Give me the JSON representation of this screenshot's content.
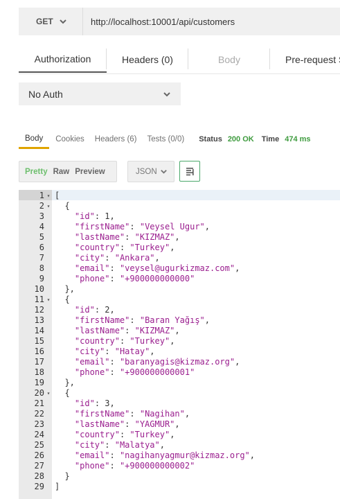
{
  "request": {
    "method": "GET",
    "url": "http://localhost:10001/api/customers"
  },
  "request_tabs": [
    {
      "label": "Authorization",
      "state": "active"
    },
    {
      "label": "Headers (0)",
      "state": "normal"
    },
    {
      "label": "Body",
      "state": "disabled"
    },
    {
      "label": "Pre-request S",
      "state": "normal"
    }
  ],
  "auth": {
    "type": "No Auth"
  },
  "response_tabs": [
    {
      "label": "Body",
      "state": "active"
    },
    {
      "label": "Cookies",
      "state": "normal"
    },
    {
      "label": "Headers (6)",
      "state": "normal"
    },
    {
      "label": "Tests (0/0)",
      "state": "normal"
    }
  ],
  "status": {
    "status_label": "Status",
    "status_value": "200 OK",
    "time_label": "Time",
    "time_value": "474 ms"
  },
  "viewer": {
    "modes": [
      "Pretty",
      "Raw",
      "Preview"
    ],
    "active_mode": "Pretty",
    "format": "JSON"
  },
  "colors": {
    "accent_tab": "#e0a400",
    "status_ok": "#3e9b3e",
    "json_string": "#9a1d8e",
    "wrap_border": "#4aa86a"
  },
  "code_lines": [
    {
      "n": "1",
      "fold": true,
      "text": "["
    },
    {
      "n": "2",
      "fold": true,
      "text": "  {"
    },
    {
      "n": "3",
      "key": "\"id\"",
      "num": "1",
      "indent": "    ",
      "tail": ","
    },
    {
      "n": "4",
      "key": "\"firstName\"",
      "str": "\"Veysel Ugur\"",
      "indent": "    ",
      "tail": ","
    },
    {
      "n": "5",
      "key": "\"lastName\"",
      "str": "\"KIZMAZ\"",
      "indent": "    ",
      "tail": ","
    },
    {
      "n": "6",
      "key": "\"country\"",
      "str": "\"Turkey\"",
      "indent": "    ",
      "tail": ","
    },
    {
      "n": "7",
      "key": "\"city\"",
      "str": "\"Ankara\"",
      "indent": "    ",
      "tail": ","
    },
    {
      "n": "8",
      "key": "\"email\"",
      "str": "\"veysel@ugurkizmaz.com\"",
      "indent": "    ",
      "tail": ","
    },
    {
      "n": "9",
      "key": "\"phone\"",
      "str": "\"+900000000000\"",
      "indent": "    ",
      "tail": ""
    },
    {
      "n": "10",
      "text": "  },"
    },
    {
      "n": "11",
      "fold": true,
      "text": "  {"
    },
    {
      "n": "12",
      "key": "\"id\"",
      "num": "2",
      "indent": "    ",
      "tail": ","
    },
    {
      "n": "13",
      "key": "\"firstName\"",
      "str": "\"Baran Yağış\"",
      "indent": "    ",
      "tail": ","
    },
    {
      "n": "14",
      "key": "\"lastName\"",
      "str": "\"KIZMAZ\"",
      "indent": "    ",
      "tail": ","
    },
    {
      "n": "15",
      "key": "\"country\"",
      "str": "\"Turkey\"",
      "indent": "    ",
      "tail": ","
    },
    {
      "n": "16",
      "key": "\"city\"",
      "str": "\"Hatay\"",
      "indent": "    ",
      "tail": ","
    },
    {
      "n": "17",
      "key": "\"email\"",
      "str": "\"baranyagis@kizmaz.org\"",
      "indent": "    ",
      "tail": ","
    },
    {
      "n": "18",
      "key": "\"phone\"",
      "str": "\"+900000000001\"",
      "indent": "    ",
      "tail": ""
    },
    {
      "n": "19",
      "text": "  },"
    },
    {
      "n": "20",
      "fold": true,
      "text": "  {"
    },
    {
      "n": "21",
      "key": "\"id\"",
      "num": "3",
      "indent": "    ",
      "tail": ","
    },
    {
      "n": "22",
      "key": "\"firstName\"",
      "str": "\"Nagihan\"",
      "indent": "    ",
      "tail": ","
    },
    {
      "n": "23",
      "key": "\"lastName\"",
      "str": "\"YAGMUR\"",
      "indent": "    ",
      "tail": ","
    },
    {
      "n": "24",
      "key": "\"country\"",
      "str": "\"Turkey\"",
      "indent": "    ",
      "tail": ","
    },
    {
      "n": "25",
      "key": "\"city\"",
      "str": "\"Malatya\"",
      "indent": "    ",
      "tail": ","
    },
    {
      "n": "26",
      "key": "\"email\"",
      "str": "\"nagihanyagmur@kizmaz.org\"",
      "indent": "    ",
      "tail": ","
    },
    {
      "n": "27",
      "key": "\"phone\"",
      "str": "\"+900000000002\"",
      "indent": "    ",
      "tail": ""
    },
    {
      "n": "28",
      "text": "  }"
    },
    {
      "n": "29",
      "text": "]"
    }
  ]
}
